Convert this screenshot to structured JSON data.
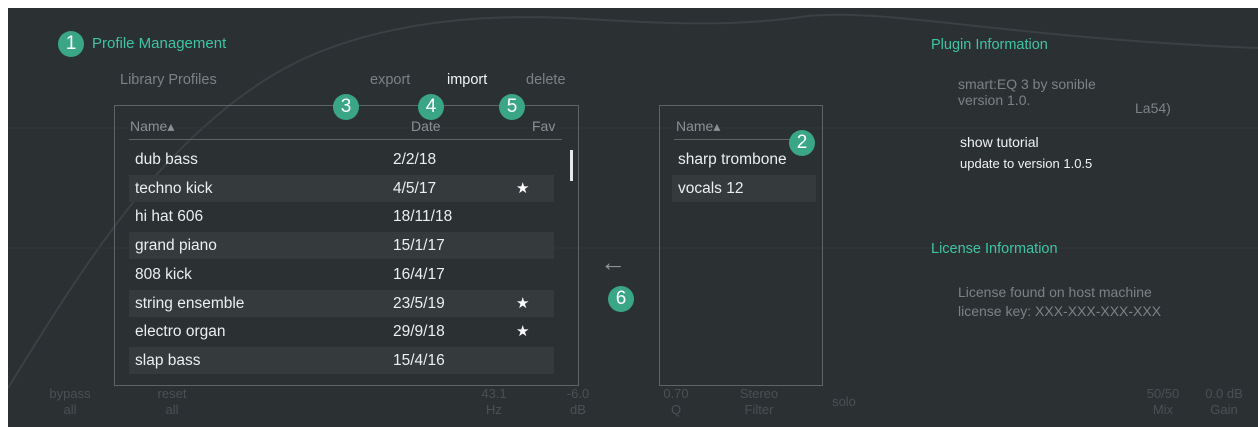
{
  "profile": {
    "title": "Profile Management",
    "badge": "1",
    "library_label": "Library Profiles",
    "actions": [
      "export",
      "import",
      "delete"
    ]
  },
  "library": {
    "col_name": "Name▴",
    "col_date": "Date",
    "col_fav": "Fav",
    "rows": [
      {
        "name": "dub bass",
        "date": "2/2/18",
        "fav": ""
      },
      {
        "name": "techno kick",
        "date": "4/5/17",
        "fav": "★"
      },
      {
        "name": "hi hat 606",
        "date": "18/11/18",
        "fav": ""
      },
      {
        "name": "grand piano",
        "date": "15/1/17",
        "fav": ""
      },
      {
        "name": "808 kick",
        "date": "16/4/17",
        "fav": ""
      },
      {
        "name": "string ensemble",
        "date": "23/5/19",
        "fav": "★"
      },
      {
        "name": "electro organ",
        "date": "29/9/18",
        "fav": "★"
      },
      {
        "name": "slap bass",
        "date": "15/4/16",
        "fav": ""
      }
    ],
    "badges": [
      "3",
      "4",
      "5"
    ]
  },
  "import_list": {
    "col_name": "Name▴",
    "badge": "2",
    "rows": [
      "sharp trombone",
      "vocals 12"
    ]
  },
  "arrow": {
    "glyph": "←",
    "badge": "6"
  },
  "plugin": {
    "title": "Plugin Information",
    "line1": "smart:EQ 3 by sonible",
    "line2": "version 1.0.",
    "line2_suffix": "La54)",
    "tutorial": "show tutorial",
    "update": "update to version 1.0.5"
  },
  "license": {
    "title": "License Information",
    "line1": "License found on host machine",
    "line2": "license key:  XXX-XXX-XXX-XXX"
  },
  "bottom_bar": [
    {
      "top": "bypass",
      "bottom": "all"
    },
    {
      "top": "reset",
      "bottom": "all"
    },
    {
      "top": "43.1",
      "bottom": "Hz"
    },
    {
      "top": "-6.0",
      "bottom": "dB"
    },
    {
      "top": "0.70",
      "bottom": "Q"
    },
    {
      "top": "Stereo",
      "bottom": "Filter"
    },
    {
      "top": "solo",
      "bottom": ""
    },
    {
      "top": "50/50",
      "bottom": "Mix"
    },
    {
      "top": "0.0 dB",
      "bottom": "Gain"
    }
  ],
  "colors": {
    "accent": "#3fc4a4",
    "badge": "#3aa685",
    "background": "#2b3033"
  }
}
